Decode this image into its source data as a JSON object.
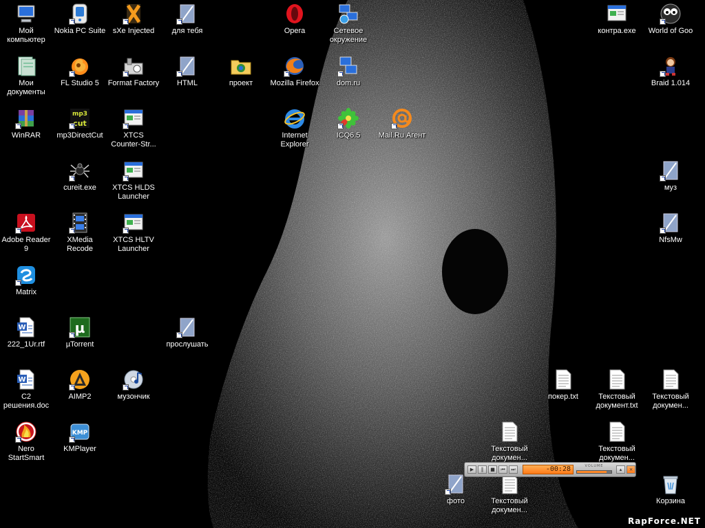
{
  "icons": {
    "my_computer": "Мой\nкомпьютер",
    "nokia": "Nokia PC Suite",
    "sxe": "sXe Injected",
    "dlya_tebya": "для тебя",
    "opera": "Opera",
    "network": "Сетевое\nокружение",
    "kontra": "контра.exe",
    "world_of_goo": "World of Goo",
    "my_documents": "Мои\nдокументы",
    "fl_studio": "FL Studio 5",
    "format_factory": "Format Factory",
    "html": "HTML",
    "proekt": "проект",
    "firefox": "Mozilla Firefox",
    "dom_ru": "dom.ru",
    "braid": "Braid 1.014",
    "winrar": "WinRAR",
    "mp3directcut": "mp3DirectCut",
    "xtcs_cs": "XTCS\nCounter-Str...",
    "ie": "Internet\nExplorer",
    "icq": "ICQ6.5",
    "mailru": "Mail.Ru Агент",
    "cureit": "cureit.exe",
    "xtcs_hlds": "XTCS HLDS\nLauncher",
    "muz": "муз",
    "adobe": "Adobe Reader\n9",
    "xmedia": "XMedia Recode",
    "xtcs_hltv": "XTCS HLTV\nLauncher",
    "nfsmw": "NfsMw",
    "matrix": "Matrix",
    "rtf": "222_1Ur.rtf",
    "utorrent": "µTorrent",
    "proslushat": "прослушать",
    "c2doc": "С2\nрешения.doc",
    "aimp": "AIMP2",
    "muzonchik": "музончик",
    "poker": "покер.txt",
    "txt1": "Текстовый\nдокумент.txt",
    "txt2": "Текстовый\nдокумен...",
    "nero": "Nero\nStartSmart",
    "kmplayer": "KMPlayer",
    "txt3": "Текстовый\nдокумен...",
    "txt4": "Текстовый\nдокумен...",
    "foto": "фото",
    "txt5": "Текстовый\nдокумен...",
    "recycle": "Корзина"
  },
  "player": {
    "time": "-00:28",
    "volume_label": "VOLUME",
    "volume_level": 0.85,
    "accent": "#ff8a2a"
  },
  "watermark": "RapForce.NET"
}
